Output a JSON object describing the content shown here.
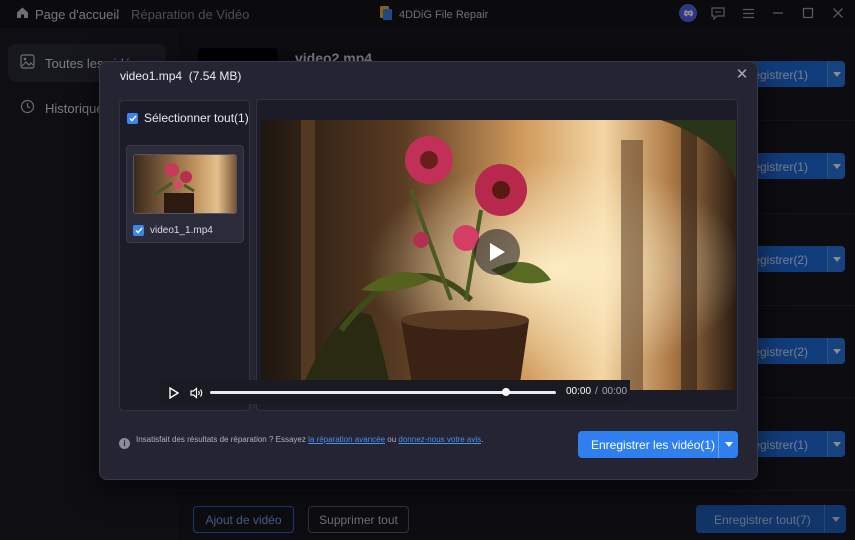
{
  "titlebar": {
    "home_label": "Page d'accueil",
    "separator": "/",
    "current_page": "Réparation de Vidéo",
    "app_title": "4DDiG File Repair"
  },
  "sidebar": {
    "items": [
      {
        "label": "Toutes les vidéos",
        "active": true
      },
      {
        "label": "Historique",
        "active": false
      }
    ]
  },
  "background_list": {
    "first_video_title": "video2.mp4",
    "rows": [
      {
        "save_label": "Enregistrer(1)"
      },
      {
        "save_label": "Enregistrer(1)"
      },
      {
        "save_label": "Enregistrer(2)"
      },
      {
        "save_label": "Enregistrer(2)"
      },
      {
        "save_label": "Enregistrer(1)"
      }
    ]
  },
  "bottom_bar": {
    "add_label": "Ajout de vidéo",
    "delete_label": "Supprimer tout",
    "save_all_label": "Enregistrer tout(7)"
  },
  "modal": {
    "title_name": "video1.mp4",
    "title_size": "(7.54 MB)",
    "select_all_label": "Sélectionner tout(1)",
    "files": [
      {
        "name": "video1_1.mp4",
        "checked": true
      }
    ],
    "player": {
      "time_current": "00:00",
      "time_separator": "/",
      "time_total": "00:00",
      "progress": 1.0
    },
    "note": {
      "prefix": "Insatisfait des résultats de réparation ? Essayez ",
      "link1": "la réparation avancée",
      "middle": " ou ",
      "link2": "donnez-nous votre avis",
      "suffix": "."
    },
    "save_label": "Enregistrer les vidéo(1)"
  },
  "colors": {
    "accent": "#2f7ff0",
    "background": "#16161f",
    "modal": "#242433"
  }
}
